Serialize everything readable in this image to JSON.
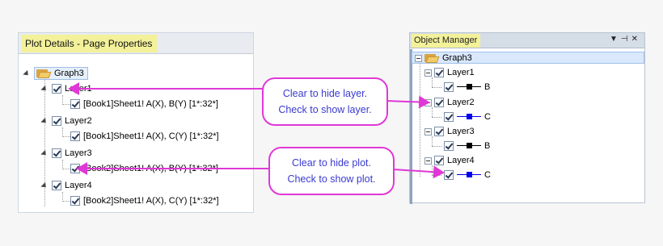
{
  "plot_details": {
    "title": "Plot Details - Page Properties",
    "graph": "Graph3",
    "layers": [
      {
        "label": "Layer1",
        "plot": "[Book1]Sheet1! A(X), B(Y) [1*:32*]"
      },
      {
        "label": "Layer2",
        "plot": "[Book1]Sheet1! A(X), C(Y) [1*:32*]"
      },
      {
        "label": "Layer3",
        "plot": "[Book2]Sheet1! A(X), B(Y) [1*:32*]"
      },
      {
        "label": "Layer4",
        "plot": "[Book2]Sheet1! A(X), C(Y) [1*:32*]"
      }
    ]
  },
  "object_manager": {
    "title": "Object Manager",
    "buttons": [
      "▼",
      "⊣",
      "✕"
    ],
    "graph": "Graph3",
    "layers": [
      {
        "label": "Layer1",
        "plot": "B",
        "color": "#000000"
      },
      {
        "label": "Layer2",
        "plot": "C",
        "color": "#0000ee"
      },
      {
        "label": "Layer3",
        "plot": "B",
        "color": "#000000"
      },
      {
        "label": "Layer4",
        "plot": "C",
        "color": "#0000ee"
      }
    ]
  },
  "callouts": {
    "layer": {
      "line1": "Clear to hide layer.",
      "line2": "Check to show layer."
    },
    "plot": {
      "line1": "Clear to hide plot.",
      "line2": "Check to show plot."
    }
  },
  "colors": {
    "accent": "#e038d6",
    "callout_text": "#3a3ad0",
    "title_highlight": "#f3f19a"
  }
}
